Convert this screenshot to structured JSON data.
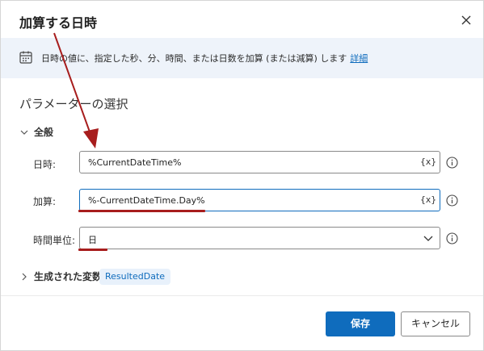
{
  "dialog": {
    "title": "加算する日時",
    "info_text": "日時の値に、指定した秒、分、時間、または日数を加算 (または減算) します",
    "info_link": "詳細",
    "section_title": "パラメーターの選択",
    "group_general": "全般",
    "fields": [
      {
        "label": "日時:",
        "value": "%CurrentDateTime%",
        "var_button": "{x}"
      },
      {
        "label": "加算:",
        "value": "%-CurrentDateTime.Day%",
        "var_button": "{x}"
      },
      {
        "label": "時間単位:",
        "value": "日"
      }
    ],
    "produced_vars_label": "生成された変数",
    "produced_var": "ResultedDate",
    "save_label": "保存",
    "cancel_label": "キャンセル"
  },
  "colors": {
    "accent": "#0f6cbd",
    "annotation": "#a71d1d",
    "info_bg": "#eef3fa"
  }
}
